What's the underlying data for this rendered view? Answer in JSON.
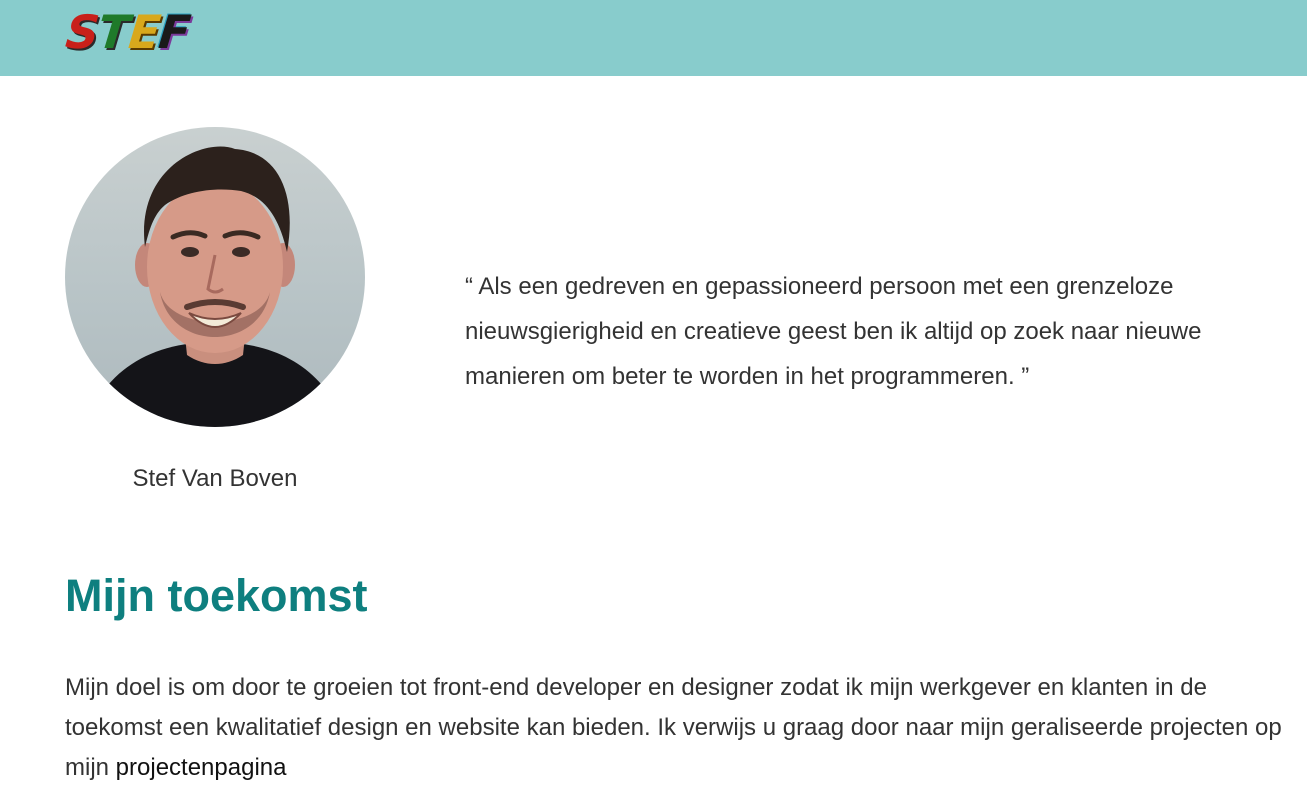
{
  "header": {
    "logo_text": "STEF",
    "logo_letters": [
      "S",
      "T",
      "E",
      "F"
    ],
    "background_color": "#88cccc"
  },
  "profile": {
    "name": "Stef Van Boven",
    "quote": "“ Als een gedreven en gepassioneerd persoon met een grenzeloze nieuwsgierigheid en creatieve geest ben ik altijd op zoek naar nieuwe manieren om beter te worden in het programmeren. ”"
  },
  "future": {
    "heading": "Mijn toekomst",
    "heading_color": "#0e7f7f",
    "paragraph": "Mijn doel is om door te groeien tot front-end developer en designer zodat ik mijn werkgever en klanten in de toekomst een kwalitatief design en website kan bieden. Ik verwijs u graag door naar mijn geraliseerde projecten op mijn ",
    "link_label": "projectenpagina"
  }
}
